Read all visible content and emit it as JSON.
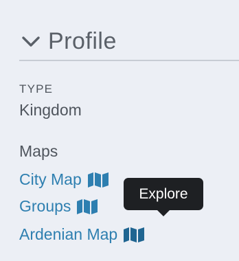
{
  "profile": {
    "title": "Profile",
    "chevron_icon": "chevron-down-icon"
  },
  "type": {
    "label": "TYPE",
    "value": "Kingdom"
  },
  "maps": {
    "label": "Maps",
    "icon": "map-icon",
    "links": [
      {
        "label": "City Map"
      },
      {
        "label": "Groups"
      },
      {
        "label": "Ardenian Map"
      }
    ]
  },
  "tooltip": {
    "text": "Explore"
  },
  "colors": {
    "background": "#eceff5",
    "text": "#4f555d",
    "link": "#2e7fb0",
    "tooltip_bg": "#1e2023"
  }
}
